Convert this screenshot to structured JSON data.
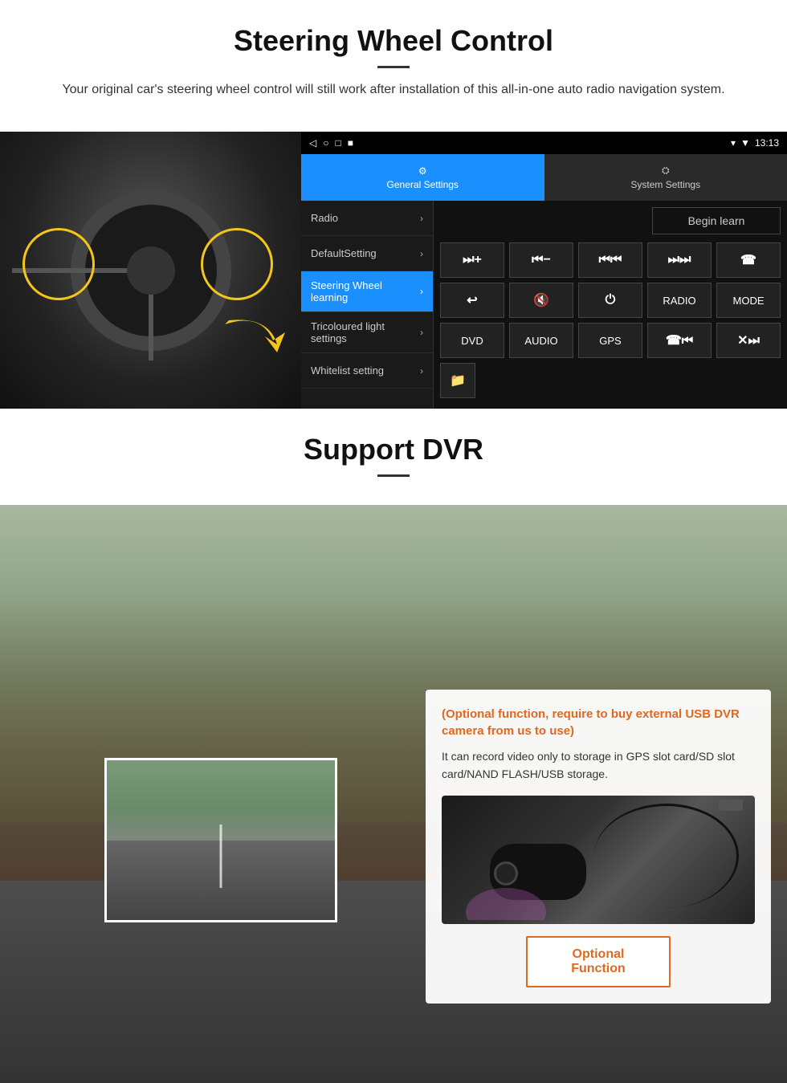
{
  "steering": {
    "title": "Steering Wheel Control",
    "description": "Your original car's steering wheel control will still work after installation of this all-in-one auto radio navigation system.",
    "status_bar": {
      "nav_icons": [
        "◁",
        "○",
        "□",
        "■"
      ],
      "time": "13:13",
      "signal": "▼",
      "wifi": "▾"
    },
    "tabs": {
      "general": {
        "label": "General Settings",
        "icon": "⚙"
      },
      "system": {
        "label": "System Settings",
        "icon": "⛭"
      }
    },
    "menu_items": [
      {
        "label": "Radio",
        "active": false
      },
      {
        "label": "DefaultSetting",
        "active": false
      },
      {
        "label": "Steering Wheel learning",
        "active": true
      },
      {
        "label": "Tricoloured light settings",
        "active": false
      },
      {
        "label": "Whitelist setting",
        "active": false
      }
    ],
    "begin_learn": "Begin learn",
    "control_buttons": {
      "row1": [
        "⏭+",
        "⏮−",
        "⏮⏮",
        "⏭⏭",
        "☎"
      ],
      "row2": [
        "↩",
        "⏺×",
        "⏻",
        "RADIO",
        "MODE"
      ],
      "row3": [
        "DVD",
        "AUDIO",
        "GPS",
        "☎⏮⏭",
        "✕⏭⏭"
      ],
      "row4": [
        "📁"
      ]
    }
  },
  "dvr": {
    "title": "Support DVR",
    "optional_note": "(Optional function, require to buy external USB DVR camera from us to use)",
    "description": "It can record video only to storage in GPS slot card/SD slot card/NAND FLASH/USB storage.",
    "optional_function_btn": "Optional Function"
  }
}
